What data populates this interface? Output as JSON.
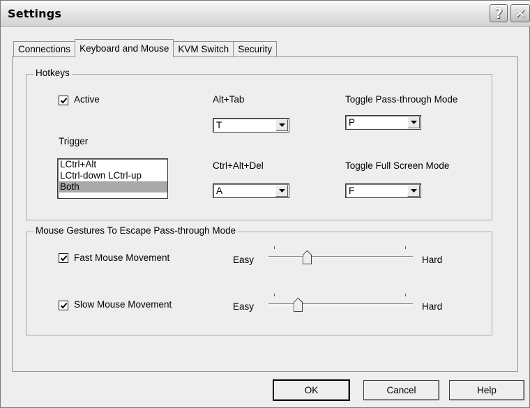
{
  "window": {
    "title": "Settings"
  },
  "titlebar": {
    "help_label": "?",
    "close_label": "✕"
  },
  "tabs": [
    {
      "label": "Connections"
    },
    {
      "label": "Keyboard and Mouse"
    },
    {
      "label": "KVM Switch"
    },
    {
      "label": "Security"
    }
  ],
  "hotkeys": {
    "legend": "Hotkeys",
    "active": {
      "label": "Active",
      "checked": true
    },
    "trigger": {
      "label": "Trigger",
      "options": [
        "LCtrl+Alt",
        "LCtrl-down LCtrl-up",
        "Both"
      ],
      "selected": "Both"
    },
    "alt_tab": {
      "label": "Alt+Tab",
      "value": "T"
    },
    "ctrl_alt_del": {
      "label": "Ctrl+Alt+Del",
      "value": "A"
    },
    "toggle_pass_through": {
      "label": "Toggle Pass-through Mode",
      "value": "P"
    },
    "toggle_full_screen": {
      "label": "Toggle Full Screen Mode",
      "value": "F"
    }
  },
  "gestures": {
    "legend": "Mouse Gestures To Escape Pass-through Mode",
    "fast": {
      "label": "Fast Mouse Movement",
      "checked": true,
      "easy_label": "Easy",
      "hard_label": "Hard",
      "level": 0.25
    },
    "slow": {
      "label": "Slow Mouse Movement",
      "checked": true,
      "easy_label": "Easy",
      "hard_label": "Hard",
      "level": 0.18
    }
  },
  "buttons": {
    "ok": "OK",
    "cancel": "Cancel",
    "help": "Help"
  }
}
